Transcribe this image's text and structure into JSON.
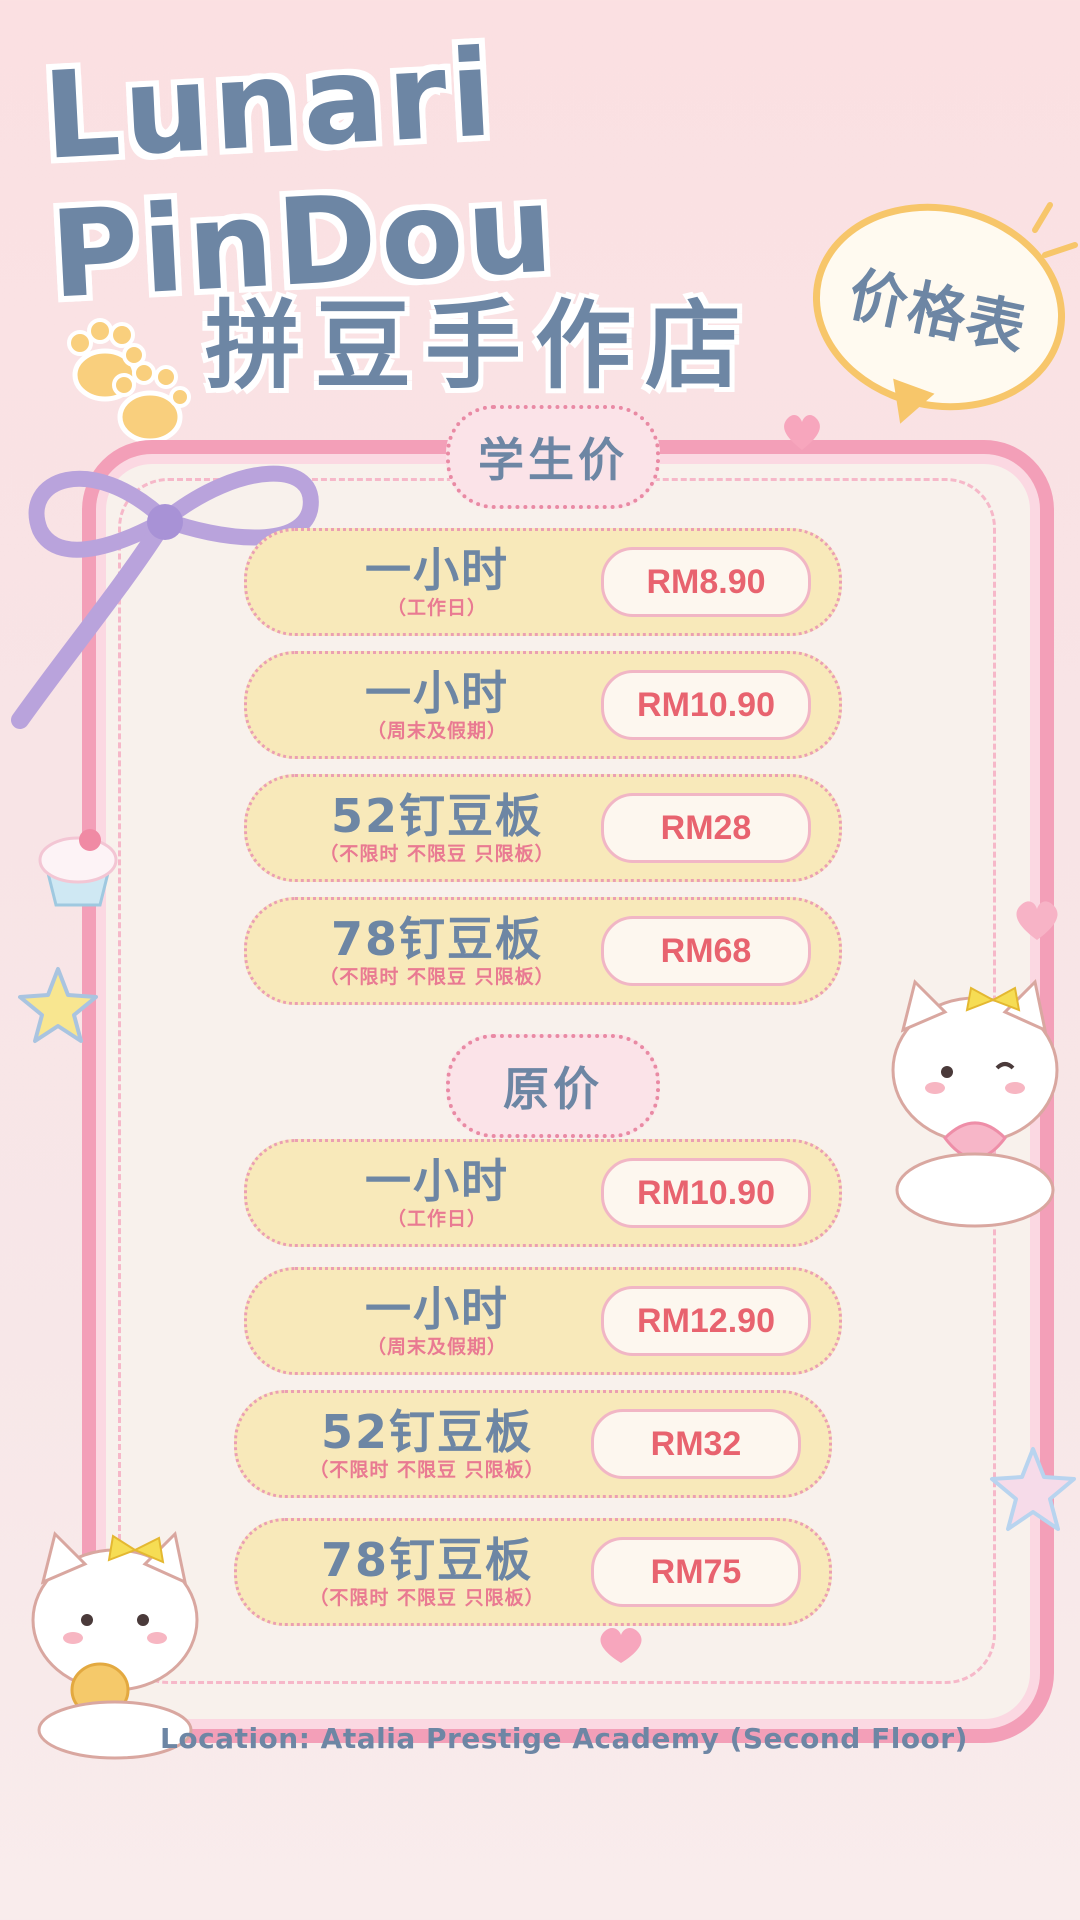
{
  "title_en": "Lunari PinDou",
  "title_cn": "拼豆手作店",
  "price_badge": "价格表",
  "sections": [
    {
      "label": "学生价",
      "rows": [
        {
          "main": "一小时",
          "sub": "（工作日）",
          "price": "RM8.90"
        },
        {
          "main": "一小时",
          "sub": "（周末及假期）",
          "price": "RM10.90"
        },
        {
          "main": "52钉豆板",
          "sub": "（不限时 不限豆 只限板）",
          "price": "RM28"
        },
        {
          "main": "78钉豆板",
          "sub": "（不限时 不限豆 只限板）",
          "price": "RM68"
        }
      ]
    },
    {
      "label": "原价",
      "rows": [
        {
          "main": "一小时",
          "sub": "（工作日）",
          "price": "RM10.90"
        },
        {
          "main": "一小时",
          "sub": "（周末及假期）",
          "price": "RM12.90"
        },
        {
          "main": "52钉豆板",
          "sub": "（不限时 不限豆 只限板）",
          "price": "RM32"
        },
        {
          "main": "78钉豆板",
          "sub": "（不限时 不限豆 只限板）",
          "price": "RM75"
        }
      ]
    }
  ],
  "location": "Location: Atalia Prestige Academy (Second Floor)",
  "colors": {
    "title": "#6d86a4",
    "price": "#e8636f",
    "accent_pink": "#f39fb8",
    "row_bg": "#f8e9ba"
  },
  "icons": [
    "paw-icon",
    "ribbon-bow-icon",
    "cupcake-icon",
    "star-icon",
    "cat-mascot-icon",
    "heart-icon"
  ]
}
